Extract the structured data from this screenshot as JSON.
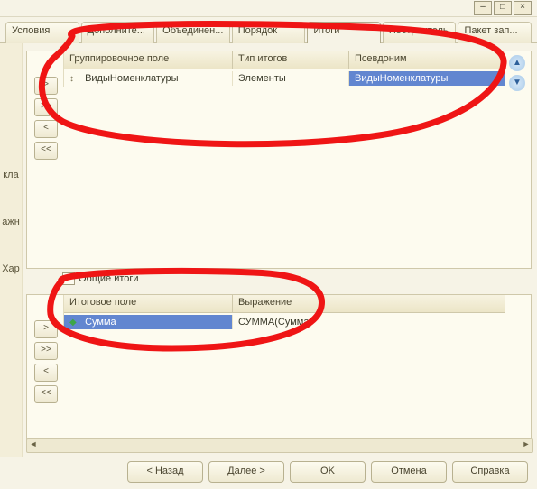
{
  "window_controls": {
    "min": "–",
    "max": "□",
    "close": "×"
  },
  "tabs": [
    {
      "label": "Условия"
    },
    {
      "label": "Дополните..."
    },
    {
      "label": "Объединен..."
    },
    {
      "label": "Порядок"
    },
    {
      "label": "Итоги",
      "active": true
    },
    {
      "label": "Построитель"
    },
    {
      "label": "Пакет зап..."
    }
  ],
  "left_strip": {
    "l1": "кла",
    "l2": "ажн",
    "l3": "Хар"
  },
  "move_buttons": {
    "add": ">",
    "add_all": ">>",
    "remove": "<",
    "remove_all": "<<"
  },
  "scroll_arrows": {
    "up": "▲",
    "down": "▼"
  },
  "top_panel": {
    "headers": {
      "col1": "Группировочное поле",
      "col2": "Тип итогов",
      "col3": "Псевдоним"
    },
    "row": {
      "field": "ВидыНоменклатуры",
      "type": "Элементы",
      "alias": "ВидыНоменклатуры"
    }
  },
  "common_totals": {
    "label": "Общие итоги",
    "checked": false
  },
  "bottom_panel": {
    "headers": {
      "col1": "Итоговое поле",
      "col2": "Выражение"
    },
    "row": {
      "field": "Сумма",
      "expr": "СУММА(Сумма)"
    }
  },
  "footer": {
    "back": "< Назад",
    "next": "Далее >",
    "ok": "OK",
    "cancel": "Отмена",
    "help": "Справка"
  },
  "scrollbar": {
    "left": "◄",
    "right": "►"
  }
}
